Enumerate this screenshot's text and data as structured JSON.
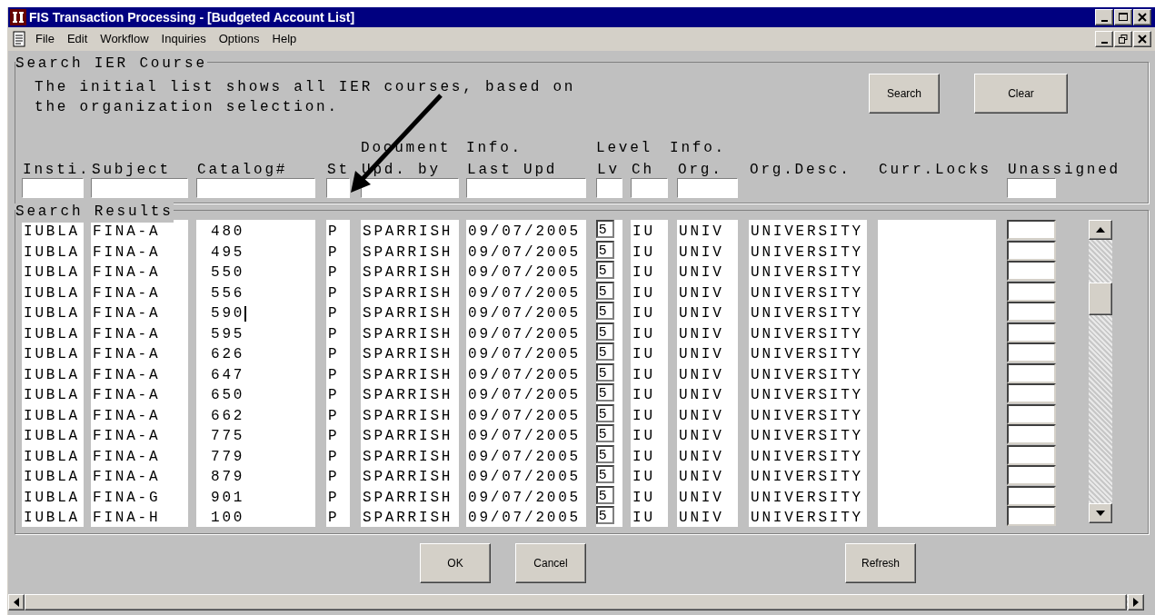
{
  "window": {
    "title": "FIS Transaction Processing - [Budgeted Account List]"
  },
  "menu": [
    "File",
    "Edit",
    "Workflow",
    "Inquiries",
    "Options",
    "Help"
  ],
  "search_panel": {
    "title": "Search IER Course",
    "description": [
      "The initial list shows all IER courses, based on",
      "the organization selection."
    ],
    "buttons": [
      "Search",
      "Clear"
    ]
  },
  "columns": [
    {
      "label": "Insti.",
      "filter": true
    },
    {
      "label": "Subject",
      "filter": true
    },
    {
      "label": "Catalog#",
      "filter": true
    },
    {
      "label": "St",
      "filter": true
    },
    {
      "group_label": "Document",
      "label": "Upd. by",
      "filter": true
    },
    {
      "group_label": "Info.",
      "label": "Last Upd",
      "filter": true
    },
    {
      "group_label": "Level",
      "label": "Lv",
      "filter": true
    },
    {
      "label": "Ch",
      "filter": true
    },
    {
      "group_label": "Info.",
      "label": "Org.",
      "filter": true
    },
    {
      "label": "Org.Desc.",
      "filter": false
    },
    {
      "label": "Curr.Locks",
      "filter": false
    },
    {
      "label": "Unassigned",
      "filter": true
    }
  ],
  "results": {
    "title": "Search Results",
    "rows": [
      {
        "cells": [
          "IUBLA",
          "FINA-A",
          "480",
          "P",
          "SPARRISH",
          "09/07/2005",
          "5",
          "IU",
          "UNIV",
          "UNIVERSITY"
        ],
        "focused": false
      },
      {
        "cells": [
          "IUBLA",
          "FINA-A",
          "495",
          "P",
          "SPARRISH",
          "09/07/2005",
          "5",
          "IU",
          "UNIV",
          "UNIVERSITY"
        ],
        "focused": false
      },
      {
        "cells": [
          "IUBLA",
          "FINA-A",
          "550",
          "P",
          "SPARRISH",
          "09/07/2005",
          "5",
          "IU",
          "UNIV",
          "UNIVERSITY"
        ],
        "focused": false
      },
      {
        "cells": [
          "IUBLA",
          "FINA-A",
          "556",
          "P",
          "SPARRISH",
          "09/07/2005",
          "5",
          "IU",
          "UNIV",
          "UNIVERSITY"
        ],
        "focused": false
      },
      {
        "cells": [
          "IUBLA",
          "FINA-A",
          "590",
          "P",
          "SPARRISH",
          "09/07/2005",
          "5",
          "IU",
          "UNIV",
          "UNIVERSITY"
        ],
        "focused": true
      },
      {
        "cells": [
          "IUBLA",
          "FINA-A",
          "595",
          "P",
          "SPARRISH",
          "09/07/2005",
          "5",
          "IU",
          "UNIV",
          "UNIVERSITY"
        ],
        "focused": false
      },
      {
        "cells": [
          "IUBLA",
          "FINA-A",
          "626",
          "P",
          "SPARRISH",
          "09/07/2005",
          "5",
          "IU",
          "UNIV",
          "UNIVERSITY"
        ],
        "focused": false
      },
      {
        "cells": [
          "IUBLA",
          "FINA-A",
          "647",
          "P",
          "SPARRISH",
          "09/07/2005",
          "5",
          "IU",
          "UNIV",
          "UNIVERSITY"
        ],
        "focused": false
      },
      {
        "cells": [
          "IUBLA",
          "FINA-A",
          "650",
          "P",
          "SPARRISH",
          "09/07/2005",
          "5",
          "IU",
          "UNIV",
          "UNIVERSITY"
        ],
        "focused": false
      },
      {
        "cells": [
          "IUBLA",
          "FINA-A",
          "662",
          "P",
          "SPARRISH",
          "09/07/2005",
          "5",
          "IU",
          "UNIV",
          "UNIVERSITY"
        ],
        "focused": false
      },
      {
        "cells": [
          "IUBLA",
          "FINA-A",
          "775",
          "P",
          "SPARRISH",
          "09/07/2005",
          "5",
          "IU",
          "UNIV",
          "UNIVERSITY"
        ],
        "focused": false
      },
      {
        "cells": [
          "IUBLA",
          "FINA-A",
          "779",
          "P",
          "SPARRISH",
          "09/07/2005",
          "5",
          "IU",
          "UNIV",
          "UNIVERSITY"
        ],
        "focused": false
      },
      {
        "cells": [
          "IUBLA",
          "FINA-A",
          "879",
          "P",
          "SPARRISH",
          "09/07/2005",
          "5",
          "IU",
          "UNIV",
          "UNIVERSITY"
        ],
        "focused": false
      },
      {
        "cells": [
          "IUBLA",
          "FINA-G",
          "901",
          "P",
          "SPARRISH",
          "09/07/2005",
          "5",
          "IU",
          "UNIV",
          "UNIVERSITY"
        ],
        "focused": false
      },
      {
        "cells": [
          "IUBLA",
          "FINA-H",
          "100",
          "P",
          "SPARRISH",
          "09/07/2005",
          "5",
          "IU",
          "UNIV",
          "UNIVERSITY"
        ],
        "focused": false
      }
    ]
  },
  "footer_buttons": [
    {
      "label": "OK",
      "kind": "ok"
    },
    {
      "label": "Cancel",
      "kind": "cancel"
    },
    {
      "label": "Refresh",
      "kind": "refresh"
    }
  ]
}
